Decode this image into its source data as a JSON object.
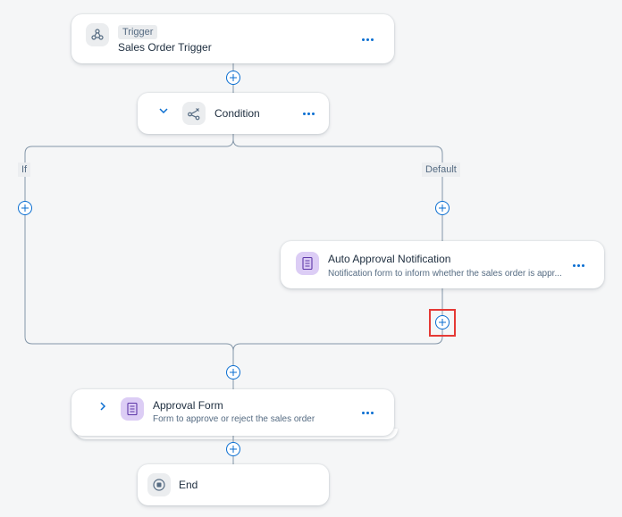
{
  "workflow": {
    "trigger": {
      "tag": "Trigger",
      "title": "Sales Order Trigger",
      "icon": "trigger-icon"
    },
    "condition": {
      "title": "Condition",
      "icon": "condition-icon"
    },
    "branches": {
      "if_label": "If",
      "default_label": "Default"
    },
    "auto_approval": {
      "title": "Auto Approval Notification",
      "subtitle": "Notification form to inform whether the sales order is appr...",
      "icon": "form-icon"
    },
    "approval_form": {
      "title": "Approval Form",
      "subtitle": "Form to approve or reject the sales order",
      "icon": "form-icon"
    },
    "end": {
      "title": "End",
      "icon": "stop-icon"
    }
  },
  "colors": {
    "accent": "#0a6ed1",
    "connector": "#8396a8",
    "highlight": "#e53935",
    "form_icon_bg": "#dccdf5"
  }
}
